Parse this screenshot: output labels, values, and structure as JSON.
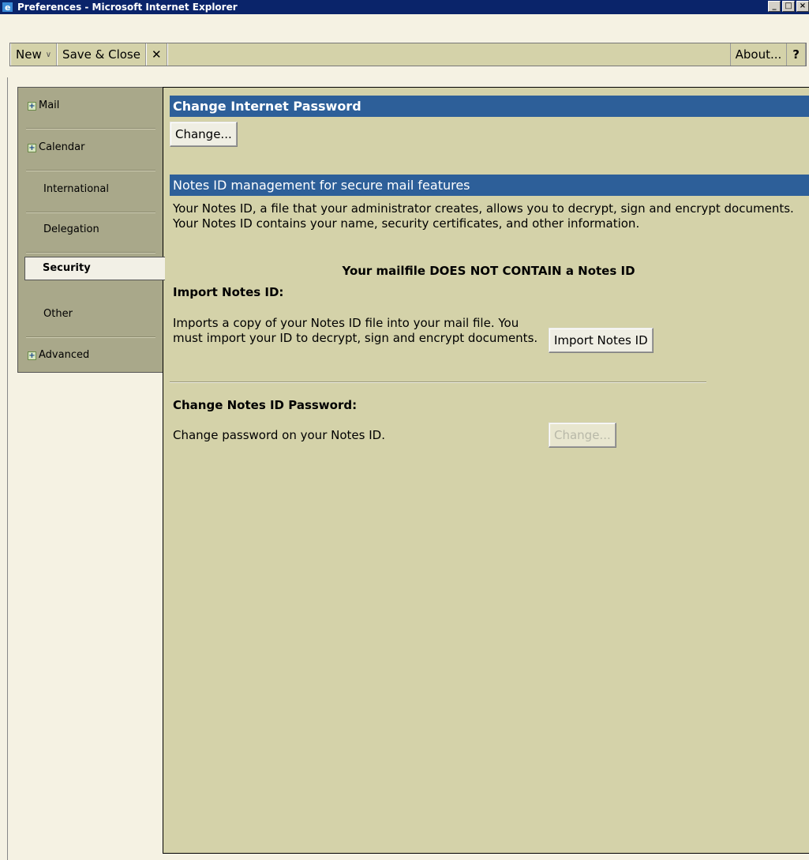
{
  "window": {
    "title": "Preferences - Microsoft Internet Explorer"
  },
  "toolbar": {
    "new_label": "New",
    "save_close_label": "Save & Close",
    "close_glyph": "✕",
    "about_label": "About...",
    "help_label": "?"
  },
  "sidebar": {
    "items": [
      {
        "label": "Mail",
        "expandable": true
      },
      {
        "label": "Calendar",
        "expandable": true
      },
      {
        "label": "International",
        "expandable": false
      },
      {
        "label": "Delegation",
        "expandable": false
      },
      {
        "label": "Security",
        "expandable": false,
        "active": true
      },
      {
        "label": "Other",
        "expandable": false
      },
      {
        "label": "Advanced",
        "expandable": true
      }
    ]
  },
  "main": {
    "internet_password": {
      "header": "Change Internet Password",
      "change_button": "Change..."
    },
    "notes_id": {
      "header": "Notes ID management for secure mail features",
      "description": "Your Notes ID, a file that your administrator creates, allows you to decrypt, sign and encrypt documents. Your Notes ID contains your name, security certificates, and other information.",
      "status": "Your mailfile DOES NOT CONTAIN a Notes ID",
      "import_title": "Import Notes ID:",
      "import_description": "Imports a copy of your Notes ID file into your mail file. You must import your ID to decrypt, sign and encrypt documents.",
      "import_button": "Import Notes ID",
      "change_pw_title": "Change Notes ID Password:",
      "change_pw_description": "Change password on your Notes ID.",
      "change_pw_button": "Change..."
    }
  },
  "colors": {
    "title_bar": "#0a246a",
    "section_header": "#2d5f99",
    "panel_bg": "#d4d2a9",
    "sidebar_bg": "#a9a88a"
  }
}
